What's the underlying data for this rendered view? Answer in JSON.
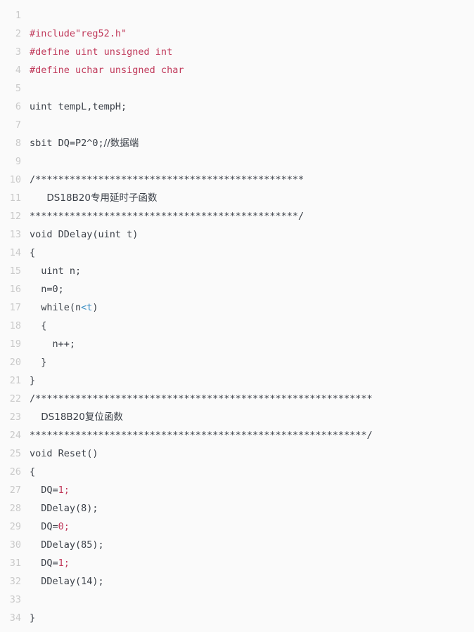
{
  "editor": {
    "background_color": "#fafafa",
    "gutter_color": "#c9c9c9",
    "text_color": "#3b4048",
    "preprocessor_color": "#c0395a",
    "number_color": "#c0395a",
    "operator_color": "#3a8ec4",
    "language": "C",
    "first_line_number": 1,
    "last_line_number": 34
  },
  "lines": [
    {
      "n": "1",
      "text": ""
    },
    {
      "n": "2",
      "text": "#include\"reg52.h\""
    },
    {
      "n": "3",
      "text": "#define uint unsigned int"
    },
    {
      "n": "4",
      "text": "#define uchar unsigned char"
    },
    {
      "n": "5",
      "text": ""
    },
    {
      "n": "6",
      "text": "uint tempL,tempH;"
    },
    {
      "n": "7",
      "text": ""
    },
    {
      "n": "8",
      "text": "sbit DQ=P2^0;//数据端"
    },
    {
      "n": "9",
      "text": ""
    },
    {
      "n": "10",
      "text": "/***********************************************"
    },
    {
      "n": "11",
      "text": "   DS18B20专用延时子函数"
    },
    {
      "n": "12",
      "text": "***********************************************/"
    },
    {
      "n": "13",
      "text": "void DDelay(uint t)"
    },
    {
      "n": "14",
      "text": "{"
    },
    {
      "n": "15",
      "text": "  uint n;"
    },
    {
      "n": "16",
      "text": "  n=0;"
    },
    {
      "n": "17",
      "text": "  while(n<t)"
    },
    {
      "n": "18",
      "text": "  {"
    },
    {
      "n": "19",
      "text": "    n++;"
    },
    {
      "n": "20",
      "text": "  }"
    },
    {
      "n": "21",
      "text": "}"
    },
    {
      "n": "22",
      "text": "/***********************************************************"
    },
    {
      "n": "23",
      "text": "  DS18B20复位函数"
    },
    {
      "n": "24",
      "text": "***********************************************************/"
    },
    {
      "n": "25",
      "text": "void Reset()"
    },
    {
      "n": "26",
      "text": "{"
    },
    {
      "n": "27",
      "text": "  DQ=1;"
    },
    {
      "n": "28",
      "text": "  DDelay(8);"
    },
    {
      "n": "29",
      "text": "  DQ=0;"
    },
    {
      "n": "30",
      "text": "  DDelay(85);"
    },
    {
      "n": "31",
      "text": "  DQ=1;"
    },
    {
      "n": "32",
      "text": "  DDelay(14);"
    },
    {
      "n": "33",
      "text": ""
    },
    {
      "n": "34",
      "text": "}"
    }
  ],
  "tokens": {
    "line2": {
      "directive": "#include\"reg52.h\""
    },
    "line3": {
      "directive": "#define uint unsigned int"
    },
    "line4": {
      "directive": "#define uchar unsigned char"
    },
    "line6": {
      "decl": "uint tempL,tempH;"
    },
    "line8": {
      "decl": "sbit DQ=P2^0;",
      "comment": "//数据端"
    },
    "line10": {
      "stars": "/***********************************************"
    },
    "line11": {
      "indent": "   ",
      "label": "DS18B20专用延时子函数"
    },
    "line12": {
      "stars": "***********************************************/"
    },
    "line13": {
      "sig": "void DDelay(uint t)"
    },
    "line14": {
      "brace": "{"
    },
    "line15": {
      "stmt": "  uint n;"
    },
    "line16": {
      "stmt": "  n=0;"
    },
    "line17": {
      "before": "  while(n",
      "op": "<t",
      "after": ")"
    },
    "line18": {
      "brace": "  {"
    },
    "line19": {
      "stmt": "    n++;"
    },
    "line20": {
      "brace": "  }"
    },
    "line21": {
      "brace": "}"
    },
    "line22": {
      "stars": "/***********************************************************"
    },
    "line23": {
      "indent": "  ",
      "label": "DS18B20复位函数"
    },
    "line24": {
      "stars": "***********************************************************/"
    },
    "line25": {
      "sig": "void Reset()"
    },
    "line26": {
      "brace": "{"
    },
    "line27": {
      "before": "  DQ=",
      "num": "1",
      "after": ";"
    },
    "line28": {
      "stmt": "  DDelay(8);"
    },
    "line29": {
      "before": "  DQ=",
      "num": "0",
      "after": ";"
    },
    "line30": {
      "stmt": "  DDelay(85);"
    },
    "line31": {
      "before": "  DQ=",
      "num": "1",
      "after": ";"
    },
    "line32": {
      "stmt": "  DDelay(14);"
    },
    "line34": {
      "brace": "}"
    }
  }
}
